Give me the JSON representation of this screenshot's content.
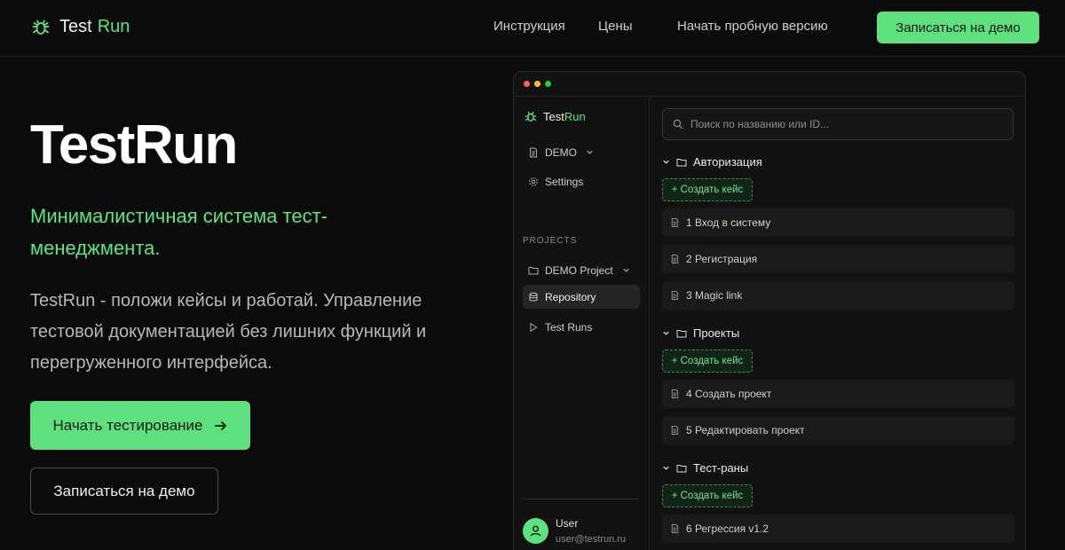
{
  "nav": {
    "brand_first": "Test",
    "brand_second": "Run",
    "links": [
      "Инструкция",
      "Цены",
      "Начать пробную версию"
    ],
    "demo_button": "Записаться на демо"
  },
  "hero": {
    "title": "TestRun",
    "tagline": "Минималистичная система тест-менеджмента.",
    "description": "TestRun - положи кейсы и работай. Управление тестовой документацией без лишних функций и перегруженного интерфейса.",
    "primary_button": "Начать тестирование",
    "secondary_button": "Записаться на демо"
  },
  "app": {
    "brand_first": "Test",
    "brand_second": "Run",
    "sidebar": {
      "workspace": "DEMO",
      "settings": "Settings",
      "section_label": "PROJECTS",
      "project": "DEMO Project",
      "repository": "Repository",
      "test_runs": "Test Runs",
      "active_item": "Repository"
    },
    "user": {
      "name": "User",
      "email": "user@testrun.ru"
    },
    "search": {
      "placeholder": "Поиск по названию или ID..."
    },
    "create_case_label": "+ Создать кейс",
    "folders": [
      {
        "name": "Авторизация",
        "cases": [
          "1 Вход в систему",
          "2 Регистрация",
          "3 Magic link"
        ]
      },
      {
        "name": "Проекты",
        "cases": [
          "4 Создать проект",
          "5 Редактировать проект"
        ]
      },
      {
        "name": "Тест-раны",
        "cases": [
          "6 Регрессия v1.2"
        ]
      }
    ]
  },
  "colors": {
    "accent": "#5fe07f",
    "background": "#0b0b0b",
    "window_dots": [
      "#ff5f57",
      "#febc2e",
      "#28c840"
    ]
  },
  "icons": [
    "bug-icon",
    "arrow-right-icon",
    "document-icon",
    "chevron-down-icon",
    "gear-icon",
    "folder-icon",
    "database-icon",
    "play-icon",
    "search-icon",
    "user-icon"
  ]
}
